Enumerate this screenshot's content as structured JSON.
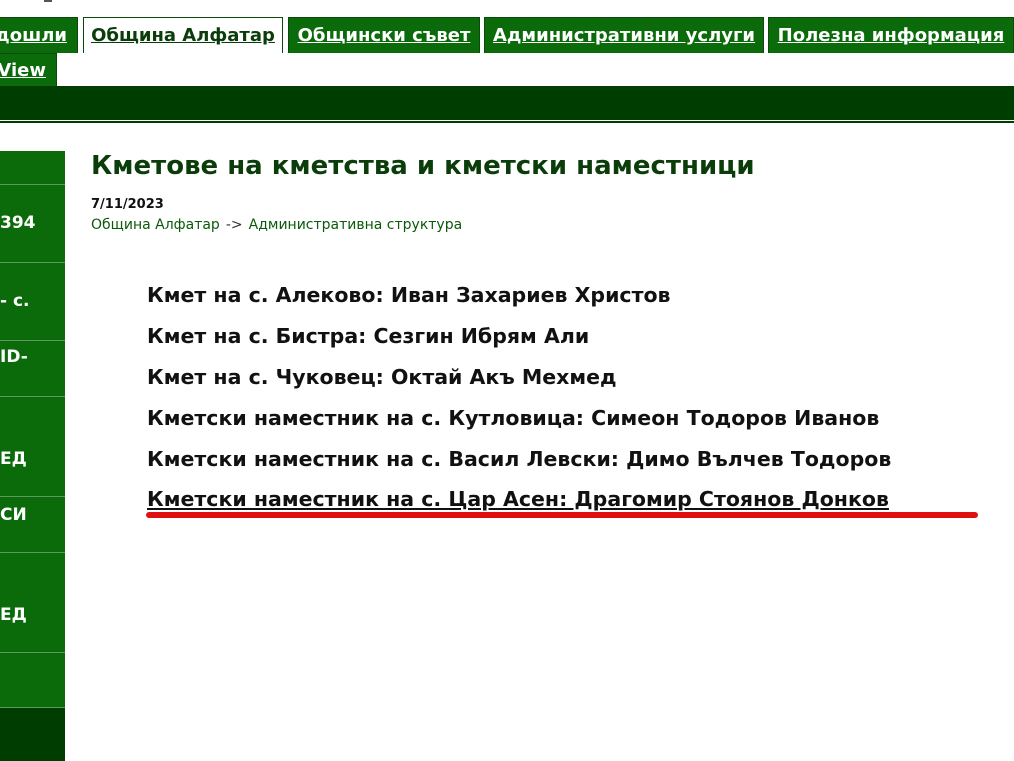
{
  "tabs": [
    {
      "label": "дошли",
      "active": false
    },
    {
      "label": "Община Алфатар",
      "active": true
    },
    {
      "label": "Общински съвет",
      "active": false
    },
    {
      "label": "Административни услуги",
      "active": false
    },
    {
      "label": "Полезна информация",
      "active": false
    },
    {
      "label": "View",
      "active": false
    }
  ],
  "sidebar": {
    "items": [
      {
        "label": ""
      },
      {
        "label": "394"
      },
      {
        "label": "- с."
      },
      {
        "label": "ID-"
      },
      {
        "label": "ЕД"
      },
      {
        "label": "СИ"
      },
      {
        "label": "ЕД"
      },
      {
        "label": ""
      }
    ]
  },
  "page": {
    "title": "Кметове на кметства и кметски наместници",
    "date": "7/11/2023",
    "breadcrumb": {
      "first": "Община Алфатар",
      "separator": "->",
      "second": "Административна структура"
    }
  },
  "mayors": [
    "Кмет на с. Алеково: Иван Захариев Христов",
    "Кмет на с. Бистра: Сезгин Ибрям Али",
    "Кмет на с. Чуковец: Октай Акъ Мехмед",
    "Кметски наместник на с. Кутловица: Симеон Тодоров Иванов",
    "Кметски наместник на с. Васил Левски: Димо Вълчев Тодоров",
    "Кметски наместник на с. Цар Асен: Драгомир Стоянов Донков"
  ],
  "colors": {
    "nav_green": "#0b6b0b",
    "dark_green": "#003d00",
    "highlight_red": "#e01010"
  }
}
